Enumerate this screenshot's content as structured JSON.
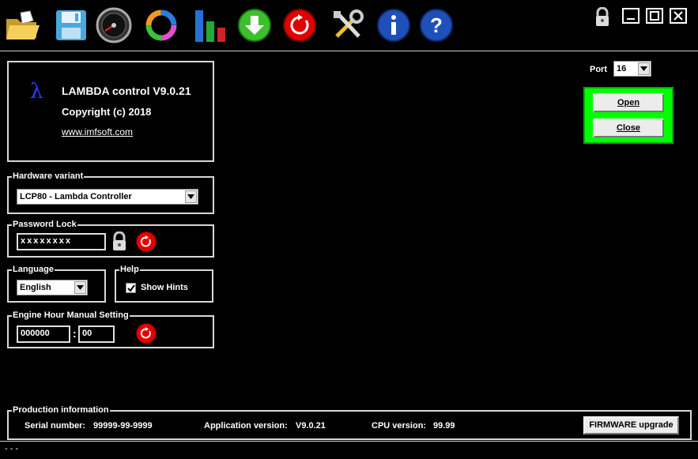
{
  "toolbar": {
    "icons": [
      "open-folder-icon",
      "save-icon",
      "gauge-icon",
      "refresh-cycle-icon",
      "bar-chart-icon",
      "download-icon",
      "reset-icon",
      "tools-icon",
      "info-icon",
      "help-icon"
    ]
  },
  "about": {
    "symbol": "λ",
    "title": "LAMBDA control  V9.0.21",
    "copyright": "Copyright (c) 2018",
    "link": "www.imfsoft.com"
  },
  "port": {
    "label": "Port",
    "value": "16"
  },
  "connection": {
    "open_label": "Open",
    "close_label": "Close",
    "accent": "#00ff00"
  },
  "hardware": {
    "title": "Hardware variant",
    "value": "LCP80 - Lambda Controller"
  },
  "password": {
    "title": "Password Lock",
    "value": "xxxxxxxx"
  },
  "language": {
    "title": "Language",
    "value": "English"
  },
  "help": {
    "title": "Help",
    "show_hints_label": "Show Hints",
    "show_hints_checked": true
  },
  "engine_hour": {
    "title": "Engine Hour Manual Setting",
    "hours": "000000",
    "separator": ":",
    "minutes": "00"
  },
  "production": {
    "title": "Production information",
    "serial_label": "Serial number:",
    "serial_value": "99999-99-9999",
    "app_version_label": "Application version:",
    "app_version_value": "V9.0.21",
    "cpu_version_label": "CPU version:",
    "cpu_version_value": "99.99",
    "firmware_button": "FIRMWARE upgrade"
  },
  "status": {
    "text": "- - -"
  },
  "colors": {
    "background": "#000000",
    "red_button": "#e10000",
    "green_panel": "#00ff00"
  }
}
